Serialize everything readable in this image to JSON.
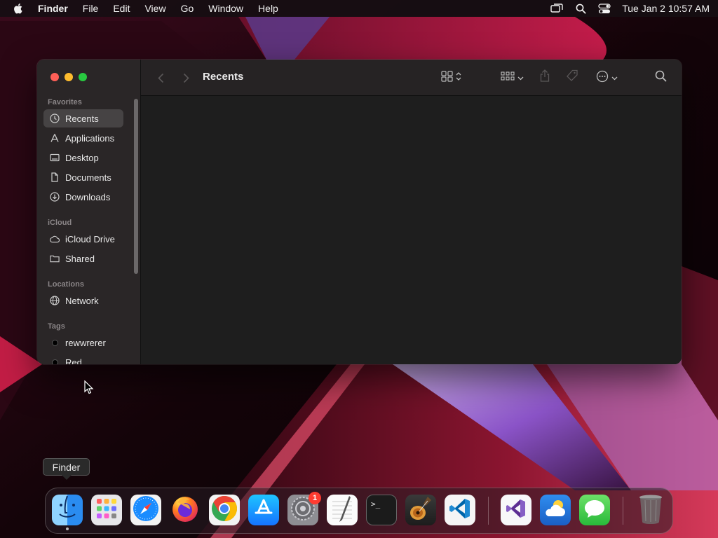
{
  "menubar": {
    "app_name": "Finder",
    "menus": [
      "File",
      "Edit",
      "View",
      "Go",
      "Window",
      "Help"
    ],
    "clock": "Tue Jan 2  10:57 AM",
    "icons": [
      "screen-mirroring-icon",
      "spotlight-search-icon",
      "control-center-icon"
    ]
  },
  "finder": {
    "title": "Recents",
    "sidebar": {
      "sections": {
        "favorites": "Favorites",
        "icloud": "iCloud",
        "locations": "Locations",
        "tags": "Tags"
      },
      "favorites": [
        {
          "label": "Recents",
          "icon": "clock-icon",
          "active": true
        },
        {
          "label": "Applications",
          "icon": "applications-icon"
        },
        {
          "label": "Desktop",
          "icon": "desktop-icon"
        },
        {
          "label": "Documents",
          "icon": "document-icon"
        },
        {
          "label": "Downloads",
          "icon": "download-icon"
        }
      ],
      "icloud": [
        {
          "label": "iCloud Drive",
          "icon": "cloud-icon"
        },
        {
          "label": "Shared",
          "icon": "shared-folder-icon"
        }
      ],
      "locations": [
        {
          "label": "Network",
          "icon": "globe-icon"
        }
      ],
      "tags": [
        {
          "label": "rewwrerer",
          "color": "#000000"
        },
        {
          "label": "Red",
          "color": "#000000"
        }
      ]
    }
  },
  "tooltip": "Finder",
  "dock": {
    "apps": [
      {
        "name": "Finder",
        "icon": "finder-icon",
        "running": true
      },
      {
        "name": "Launchpad",
        "icon": "launchpad-icon"
      },
      {
        "name": "Safari",
        "icon": "safari-icon"
      },
      {
        "name": "Firefox",
        "icon": "firefox-icon"
      },
      {
        "name": "Chrome",
        "icon": "chrome-icon"
      },
      {
        "name": "App Store",
        "icon": "app-store-icon"
      },
      {
        "name": "System Settings",
        "icon": "system-settings-icon",
        "badge": "1"
      },
      {
        "name": "TextEdit",
        "icon": "textedit-icon"
      },
      {
        "name": "Terminal",
        "icon": "terminal-icon"
      },
      {
        "name": "GarageBand",
        "icon": "garageband-icon"
      },
      {
        "name": "Visual Studio Code",
        "icon": "vscode-icon"
      },
      {
        "name": "Visual Studio",
        "icon": "visual-studio-icon"
      },
      {
        "name": "Weather",
        "icon": "weather-icon"
      },
      {
        "name": "Messages",
        "icon": "messages-icon"
      },
      {
        "name": "Trash",
        "icon": "trash-icon"
      }
    ],
    "terminal_prompt": ">_"
  },
  "colors": {
    "close": "#fe5f57",
    "minimize": "#febc2e",
    "maximize": "#28c840",
    "badge": "#ff3b30"
  }
}
